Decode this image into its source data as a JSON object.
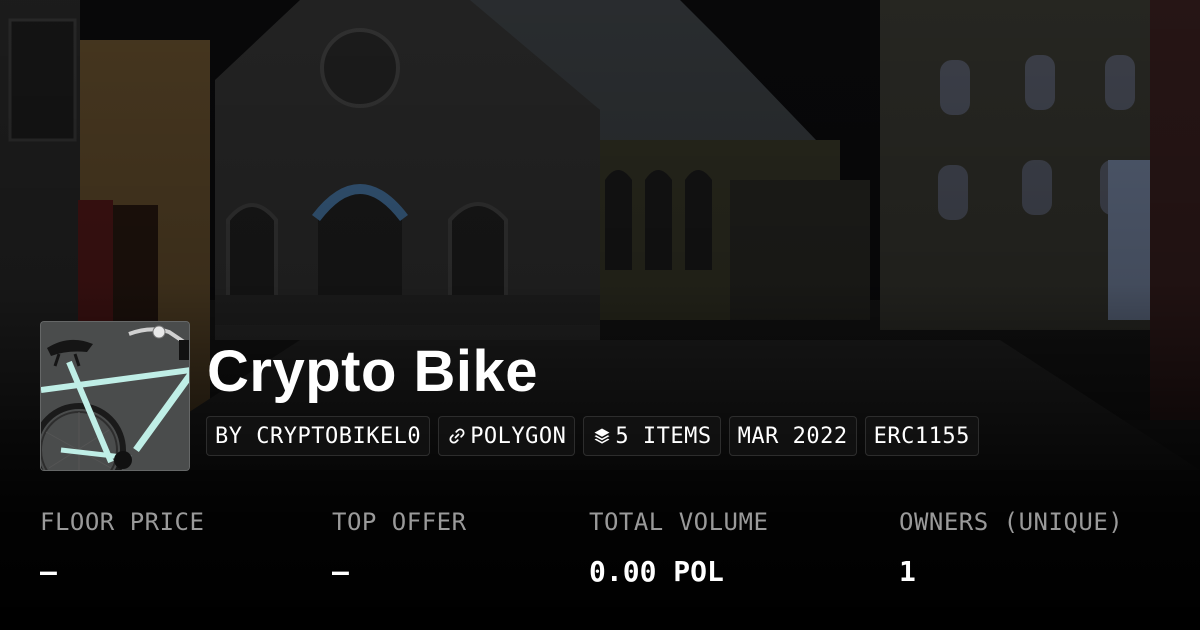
{
  "collection": {
    "name": "Crypto Bike",
    "thumbnail_icon": "bicycle-image"
  },
  "chips": [
    {
      "label": "BY CRYPTOBIKEL0",
      "icon": ""
    },
    {
      "label": "POLYGON",
      "icon": "link-icon"
    },
    {
      "label": "5 ITEMS",
      "icon": "layers-icon"
    },
    {
      "label": "MAR 2022",
      "icon": ""
    },
    {
      "label": "ERC1155",
      "icon": ""
    }
  ],
  "stats": {
    "floor_price": {
      "label": "FLOOR PRICE",
      "value": "–"
    },
    "top_offer": {
      "label": "TOP OFFER",
      "value": "–"
    },
    "total_volume": {
      "label": "TOTAL VOLUME",
      "value": "0.00 POL"
    },
    "owners": {
      "label": "OWNERS (UNIQUE)",
      "value": "1"
    }
  },
  "colors": {
    "background": "#000000",
    "label_gray": "#9a9a9a",
    "chip_bg": "#121212",
    "bike_frame": "#bfeee6"
  }
}
